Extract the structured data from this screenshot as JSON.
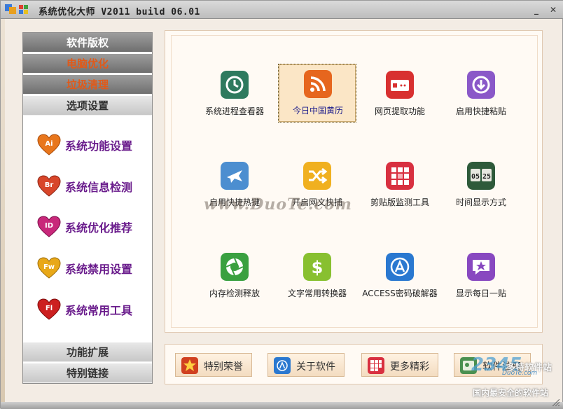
{
  "window": {
    "title": "系统优化大师 V2011 build 06.01",
    "minimize": "_",
    "close": "✕"
  },
  "sidebar": {
    "tabs": [
      {
        "label": "软件版权"
      },
      {
        "label": "电脑优化"
      },
      {
        "label": "垃圾清理"
      },
      {
        "label": "选项设置"
      }
    ],
    "menu": [
      {
        "label": "系统功能设置",
        "badge": "Ai",
        "color": "#e8761c"
      },
      {
        "label": "系统信息检测",
        "badge": "Br",
        "color": "#d8462a"
      },
      {
        "label": "系统优化推荐",
        "badge": "ID",
        "color": "#c8287a"
      },
      {
        "label": "系统禁用设置",
        "badge": "Fw",
        "color": "#e8a818"
      },
      {
        "label": "系统常用工具",
        "badge": "Fl",
        "color": "#cc2020"
      }
    ],
    "bottom_tabs": [
      {
        "label": "功能扩展"
      },
      {
        "label": "特别链接"
      }
    ]
  },
  "tools": [
    {
      "label": "系统进程查看器",
      "icon": "history-icon",
      "color": "#2e7a5e"
    },
    {
      "label": "今日中国黄历",
      "icon": "rss-icon",
      "color": "#e6661e"
    },
    {
      "label": "网页提取功能",
      "icon": "web-extract-icon",
      "color": "#d83030"
    },
    {
      "label": "启用快捷粘贴",
      "icon": "download-icon",
      "color": "#8a58c8"
    },
    {
      "label": "启用快捷热键",
      "icon": "airplane-icon",
      "color": "#4c8ed0"
    },
    {
      "label": "开启网文快捕",
      "icon": "shuffle-icon",
      "color": "#f0b020"
    },
    {
      "label": "剪贴版监测工具",
      "icon": "grid-icon",
      "color": "#d83040"
    },
    {
      "label": "时间显示方式",
      "icon": "clock-icon",
      "color": "#2e5a3a"
    },
    {
      "label": "内存检测释放",
      "icon": "aperture-icon",
      "color": "#3aa040"
    },
    {
      "label": "文字常用转换器",
      "icon": "dollar-icon",
      "color": "#88c030"
    },
    {
      "label": "ACCESS密码破解器",
      "icon": "appstore-icon",
      "color": "#2a78d0"
    },
    {
      "label": "显示每日一贴",
      "icon": "star-chat-icon",
      "color": "#8848c0"
    }
  ],
  "clock_display": "05 25",
  "watermark": "www.DuoTe.com",
  "bottom_buttons": [
    {
      "label": "特别荣誉",
      "icon": "star-icon",
      "color": "#d04020"
    },
    {
      "label": "关于软件",
      "icon": "info-icon",
      "color": "#2a78d0"
    },
    {
      "label": "更多精彩",
      "icon": "grid-icon",
      "color": "#d83040"
    },
    {
      "label": "软件注册",
      "icon": "register-icon",
      "color": "#3aa040"
    }
  ],
  "logo_watermark": {
    "brand": "2345",
    "site_cn": "多特软件站",
    "site_en": "DuoTe.com",
    "slogan": "国内最安全的软件站"
  }
}
